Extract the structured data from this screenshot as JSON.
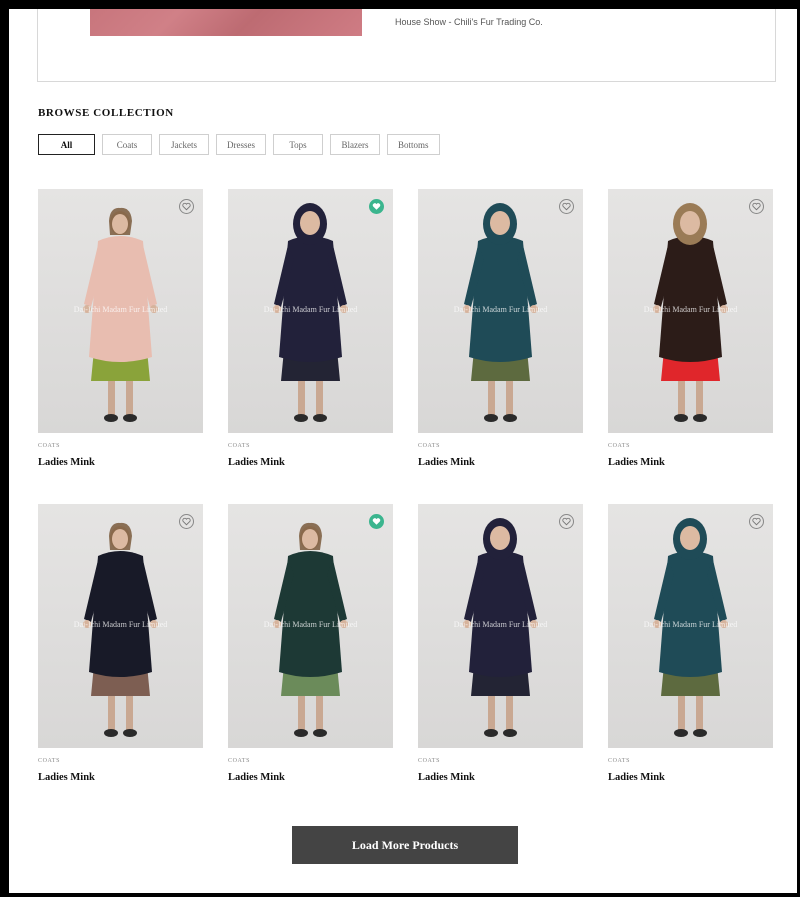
{
  "top_card": {
    "caption": "House Show - Chili's Fur Trading Co."
  },
  "browse": {
    "title": "BROWSE COLLECTION",
    "filters": [
      {
        "label": "All",
        "active": true
      },
      {
        "label": "Coats",
        "active": false
      },
      {
        "label": "Jackets",
        "active": false
      },
      {
        "label": "Dresses",
        "active": false
      },
      {
        "label": "Tops",
        "active": false
      },
      {
        "label": "Blazers",
        "active": false
      },
      {
        "label": "Bottoms",
        "active": false
      }
    ]
  },
  "products": [
    {
      "category": "COATS",
      "name": "Ladies Mink",
      "liked": false,
      "watermark": "Dai-Ichi Madam Fur Limited",
      "coat_color": "#e8bdb0",
      "skirt_color": "#8aa33a",
      "hood": false,
      "collar_color": "",
      "icon": "heart-outline-icon"
    },
    {
      "category": "COATS",
      "name": "Ladies Mink",
      "liked": true,
      "watermark": "Dai-Ichi Madam Fur Limited",
      "coat_color": "#22213a",
      "skirt_color": "#232434",
      "hood": true,
      "collar_color": "",
      "icon": "heart-filled-icon"
    },
    {
      "category": "COATS",
      "name": "Ladies Mink",
      "liked": false,
      "watermark": "Dai-Ichi Madam Fur Limited",
      "coat_color": "#1f4b57",
      "skirt_color": "#5d6a3f",
      "hood": true,
      "collar_color": "",
      "icon": "heart-outline-icon"
    },
    {
      "category": "COATS",
      "name": "Ladies Mink",
      "liked": false,
      "watermark": "Dai-Ichi Madam Fur Limited",
      "coat_color": "#2c1c18",
      "skirt_color": "#e0262b",
      "hood": true,
      "collar_color": "#9a7b56",
      "icon": "heart-outline-icon"
    },
    {
      "category": "COATS",
      "name": "Ladies Mink",
      "liked": false,
      "watermark": "Dai-Ichi Madam Fur Limited",
      "coat_color": "#181a28",
      "skirt_color": "#7d5e52",
      "hood": false,
      "collar_color": "",
      "icon": "heart-outline-icon"
    },
    {
      "category": "COATS",
      "name": "Ladies Mink",
      "liked": true,
      "watermark": "Dai-Ichi Madam Fur Limited",
      "coat_color": "#1d3935",
      "skirt_color": "#6b8b5a",
      "hood": false,
      "collar_color": "",
      "icon": "heart-filled-icon"
    },
    {
      "category": "COATS",
      "name": "Ladies Mink",
      "liked": false,
      "watermark": "Dai-Ichi Madam Fur Limited",
      "coat_color": "#22213a",
      "skirt_color": "#232434",
      "hood": true,
      "collar_color": "",
      "icon": "heart-outline-icon"
    },
    {
      "category": "COATS",
      "name": "Ladies Mink",
      "liked": false,
      "watermark": "Dai-Ichi Madam Fur Limited",
      "coat_color": "#1f4b57",
      "skirt_color": "#5d6a3f",
      "hood": true,
      "collar_color": "",
      "icon": "heart-outline-icon"
    }
  ],
  "load_more_label": "Load More Products",
  "colors": {
    "accent_liked": "#3bb58e",
    "button_bg": "#444444"
  }
}
